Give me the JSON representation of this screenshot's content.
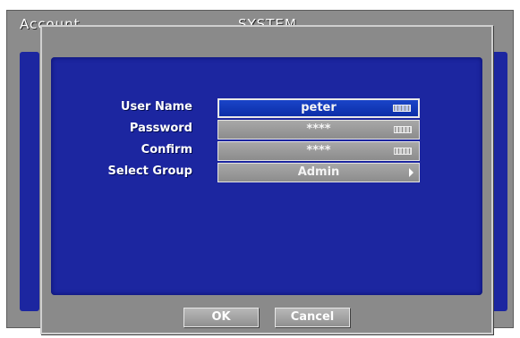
{
  "background": {
    "title_left": "Account",
    "title_center": "SYSTEM"
  },
  "form": {
    "fields": [
      {
        "label": "User Name",
        "value": "peter",
        "icon": "keyboard-icon",
        "active": true
      },
      {
        "label": "Password",
        "value": "****",
        "icon": "keyboard-icon",
        "active": false
      },
      {
        "label": "Confirm",
        "value": "****",
        "icon": "keyboard-icon",
        "active": false
      },
      {
        "label": "Select Group",
        "value": "Admin",
        "icon": "arrow-right-icon",
        "active": false
      }
    ]
  },
  "buttons": {
    "ok_label": "OK",
    "cancel_label": "Cancel"
  },
  "colors": {
    "panel_blue": "#1c26a0",
    "active_field_blue": "#0c2ea8",
    "dialog_gray": "#8a8a8a"
  }
}
